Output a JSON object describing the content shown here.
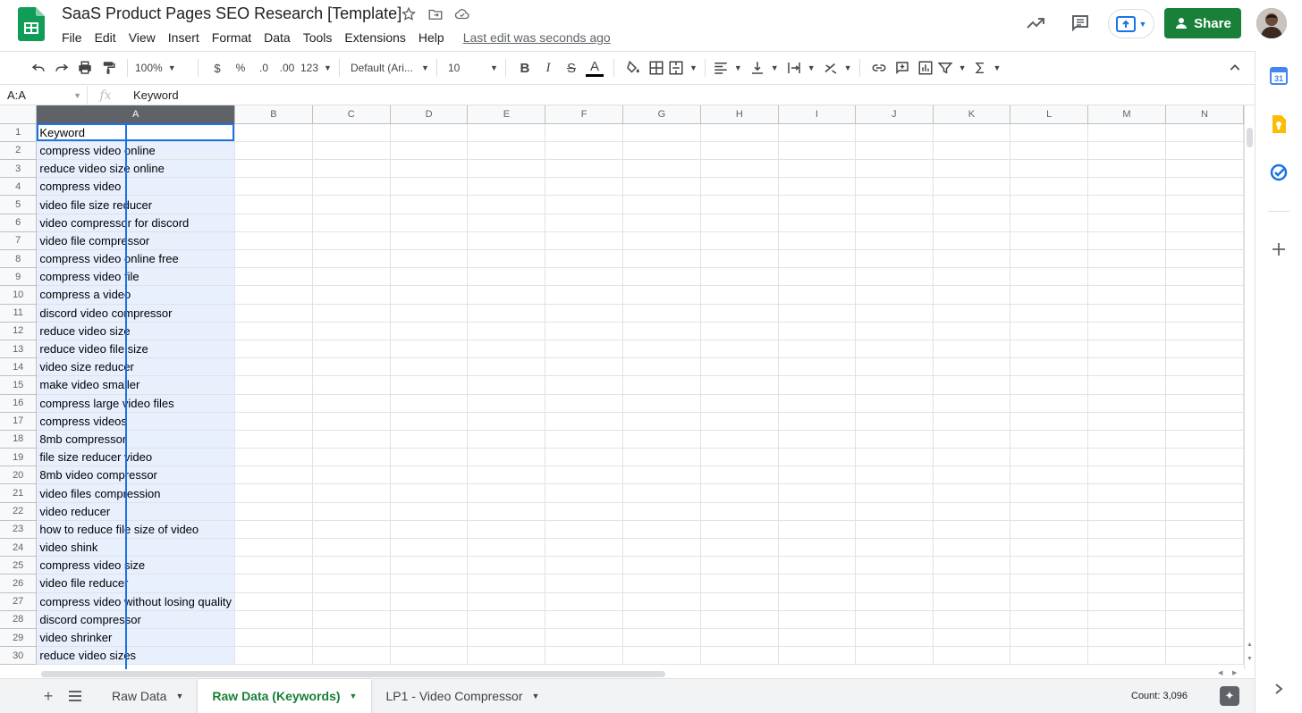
{
  "document": {
    "title": "SaaS Product Pages SEO Research [Template]",
    "last_edit": "Last edit was seconds ago"
  },
  "menu": [
    "File",
    "Edit",
    "View",
    "Insert",
    "Format",
    "Data",
    "Tools",
    "Extensions",
    "Help"
  ],
  "header": {
    "share_label": "Share"
  },
  "toolbar": {
    "zoom": "100%",
    "currency": "$",
    "percent": "%",
    "decrease_decimal": ".0",
    "increase_decimal": ".00",
    "more_formats": "123",
    "font": "Default (Ari...",
    "font_size": "10",
    "bold": "B",
    "italic": "I",
    "strikethrough": "S",
    "text_color": "A"
  },
  "formula_bar": {
    "name_box": "A:A",
    "fx": "fx",
    "content": "Keyword"
  },
  "columns": [
    "A",
    "B",
    "C",
    "D",
    "E",
    "F",
    "G",
    "H",
    "I",
    "J",
    "K",
    "L",
    "M",
    "N"
  ],
  "rows": [
    {
      "n": "1",
      "a": "Keyword"
    },
    {
      "n": "2",
      "a": "compress video online"
    },
    {
      "n": "3",
      "a": "reduce video size online"
    },
    {
      "n": "4",
      "a": "compress video"
    },
    {
      "n": "5",
      "a": "video file size reducer"
    },
    {
      "n": "6",
      "a": "video compressor for discord"
    },
    {
      "n": "7",
      "a": "video file compressor"
    },
    {
      "n": "8",
      "a": "compress video online free"
    },
    {
      "n": "9",
      "a": "compress video file"
    },
    {
      "n": "10",
      "a": "compress a video"
    },
    {
      "n": "11",
      "a": "discord video compressor"
    },
    {
      "n": "12",
      "a": "reduce video size"
    },
    {
      "n": "13",
      "a": "reduce video file size"
    },
    {
      "n": "14",
      "a": "video size reducer"
    },
    {
      "n": "15",
      "a": "make video smaller"
    },
    {
      "n": "16",
      "a": "compress large video files"
    },
    {
      "n": "17",
      "a": "compress videos"
    },
    {
      "n": "18",
      "a": "8mb compressor"
    },
    {
      "n": "19",
      "a": "file size reducer video"
    },
    {
      "n": "20",
      "a": "8mb video compressor"
    },
    {
      "n": "21",
      "a": "video files compression"
    },
    {
      "n": "22",
      "a": "video reducer"
    },
    {
      "n": "23",
      "a": "how to reduce file size of video"
    },
    {
      "n": "24",
      "a": "video shink"
    },
    {
      "n": "25",
      "a": "compress video size"
    },
    {
      "n": "26",
      "a": "video file reducer"
    },
    {
      "n": "27",
      "a": "compress video without losing quality"
    },
    {
      "n": "28",
      "a": "discord compressor"
    },
    {
      "n": "29",
      "a": "video shrinker"
    },
    {
      "n": "30",
      "a": "reduce video sizes"
    }
  ],
  "sheets": {
    "tabs": [
      "Raw Data",
      "Raw Data (Keywords)",
      "LP1 - Video Compressor"
    ],
    "active_index": 1,
    "count": "Count: 3,096"
  },
  "sidepanel": {
    "calendar_day": "31"
  },
  "colors": {
    "accent_green": "#188038",
    "selection_blue": "#1a73e8",
    "selection_fill": "#e8f0fe"
  }
}
